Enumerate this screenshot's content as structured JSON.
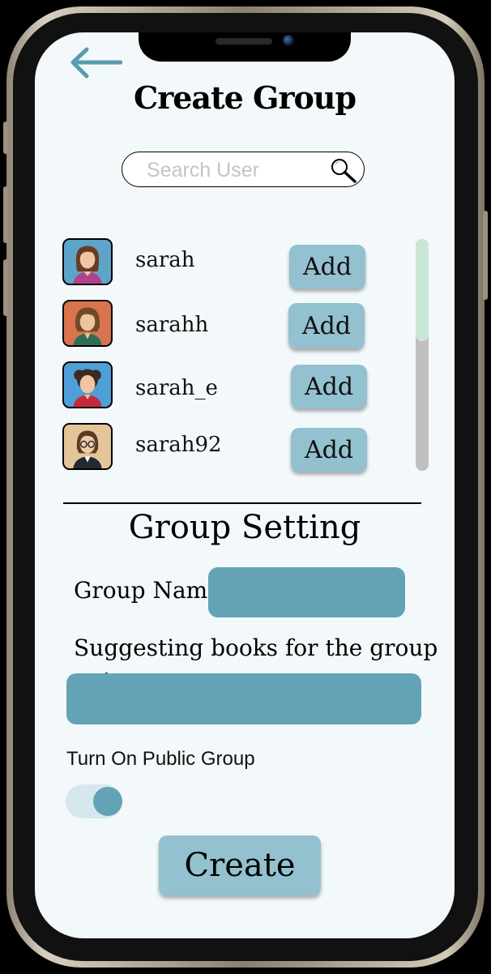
{
  "header": {
    "title": "Create Group"
  },
  "search": {
    "placeholder": "Search User"
  },
  "users": [
    {
      "name": "sarah",
      "button": "Add",
      "avatar_bg": "#5ea4c8"
    },
    {
      "name": "sarahh",
      "button": "Add",
      "avatar_bg": "#d8744e"
    },
    {
      "name": "sarah_e",
      "button": "Add",
      "avatar_bg": "#4e9fd8"
    },
    {
      "name": "sarah92",
      "button": "Add",
      "avatar_bg": "#e4c59a"
    }
  ],
  "settings": {
    "title": "Group Setting",
    "group_name_label": "Group Name:",
    "suggest_label": "Suggesting books for the group ....:",
    "public_toggle_label": "Turn On Public Group",
    "public_toggle_on": true
  },
  "actions": {
    "create_label": "Create"
  },
  "colors": {
    "accent": "#63a3b6",
    "button": "#93c1cf",
    "background": "#f3f9fa"
  }
}
